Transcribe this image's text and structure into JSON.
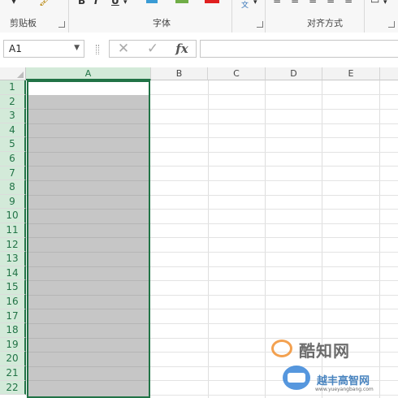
{
  "ribbon": {
    "groups": [
      {
        "label": "剪贴板",
        "name": "clipboard"
      },
      {
        "label": "字体",
        "name": "font"
      },
      {
        "label": "对齐方式",
        "name": "alignment"
      }
    ],
    "font_buttons": [
      "B",
      "I",
      "U"
    ]
  },
  "formula_bar": {
    "name_box": "A1",
    "cancel_icon": "✕",
    "enter_icon": "✓",
    "fx_label": "fx",
    "formula": ""
  },
  "sheet": {
    "columns": [
      "A",
      "B",
      "C",
      "D",
      "E"
    ],
    "rows": [
      "1",
      "2",
      "3",
      "4",
      "5",
      "6",
      "7",
      "8",
      "9",
      "10",
      "11",
      "12",
      "13",
      "14",
      "15",
      "16",
      "17",
      "18",
      "19",
      "20",
      "21",
      "22"
    ],
    "selected_column": "A",
    "active_cell": "A1"
  },
  "watermark": {
    "title": "酷知网",
    "subtitle": "越丰高智网",
    "url": "www.yueyangbang.com"
  },
  "colors": {
    "accent": "#217346",
    "selection_fill": "#c6c6c6",
    "header_bg": "#f3f3f3"
  }
}
